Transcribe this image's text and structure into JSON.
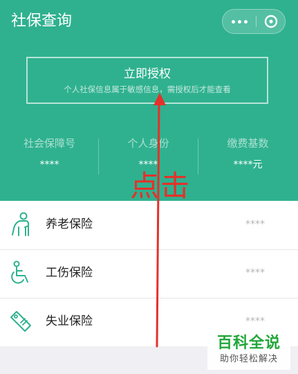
{
  "header": {
    "title": "社保查询",
    "capsule": {
      "more_icon": "more-dots-icon",
      "close_icon": "close-circle-icon"
    },
    "background_color": "#2fb18f"
  },
  "auth": {
    "title": "立即授权",
    "subtitle": "个人社保信息属于敏感信息，需授权后才能查看"
  },
  "stats": [
    {
      "label": "社会保障号",
      "value": "****"
    },
    {
      "label": "个人身份",
      "value": "****"
    },
    {
      "label": "缴费基数",
      "value": "****元"
    }
  ],
  "insurance": [
    {
      "name": "养老保险",
      "value": "****",
      "icon": "elderly-person-icon"
    },
    {
      "name": "工伤保险",
      "value": "****",
      "icon": "wheelchair-icon"
    },
    {
      "name": "失业保险",
      "value": "****",
      "icon": "tag-icon"
    }
  ],
  "annotation": {
    "text": "点击",
    "color": "#e5312a"
  },
  "watermark": {
    "main": "百科全说",
    "sub": "助你轻松解决"
  }
}
